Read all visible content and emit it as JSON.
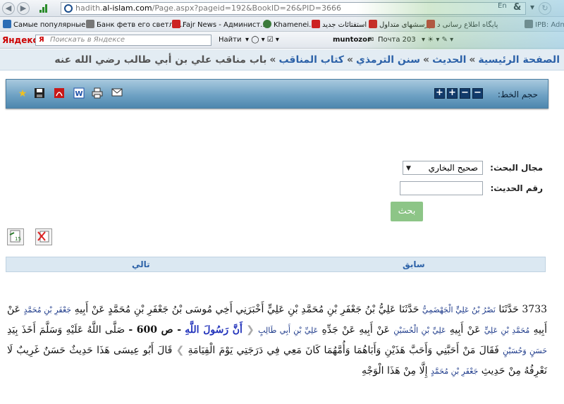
{
  "browser": {
    "url_prefix": "hadith.",
    "url_domain": "al-islam.com",
    "url_rest": "/Page.aspx?pageid=192&BookID=26&PID=3666",
    "lang_button": "En"
  },
  "bookmarks": {
    "items": [
      "Самые популярные",
      "Банк фетв его светло...",
      "Fajr News - Админист...",
      "Khamenei.ir",
      "استفتائات جدید",
      "پرسشهای متداول",
      "پایگاه اطلاع رسانی د",
      "IPB: Adm"
    ]
  },
  "yandex_bar": {
    "logo": "Яндекс",
    "search_placeholder": "Поискать в Яндексе",
    "find_label": "Найти",
    "user_label": "muntozor",
    "mail_label": "Почта 203"
  },
  "breadcrumb": {
    "home": "الصفحة الرئيسية",
    "hadith": "الحديث",
    "book": "سنن الترمذي",
    "section": "كتاب المناقب",
    "current": "باب مناقب علي بن أبي طالب رضي الله عنه"
  },
  "toolbar": {
    "font_size_label": "حجم الخط:",
    "icons": [
      "star-icon",
      "save-icon",
      "pdf-icon",
      "word-icon",
      "print-icon",
      "mail-icon"
    ]
  },
  "search": {
    "field_label": "مجال البحث:",
    "field_value": "صحيح البخاري",
    "number_label": "رقم الحديث:",
    "number_value": "",
    "submit_label": "بحث"
  },
  "navigation": {
    "prev_label": "سابق",
    "next_label": "تالي"
  },
  "hadith": {
    "number": "3733",
    "parts": [
      "حَدَّثَنَا",
      "نَصْرُ بْنُ عَلِيٍّ الْجَهْضَمِيُّ",
      "حَدَّثَنَا عَلِيُّ بْنُ جَعْفَرِ بْنِ مُحَمَّدِ بْنِ عَلِيٍّ أَخْبَرَنِي أَخِي مُوسَى بْنُ جَعْفَرِ بْنِ مُحَمَّدٍ عَنْ أَبِيهِ",
      "جَعْفَرِ بْنِ مُحَمَّدٍ",
      "عَنْ أَبِيهِ",
      "مُحَمَّدِ بْنِ عَلِيٍّ",
      "عَنْ أَبِيهِ",
      "عَلِيِّ بْنِ الْحُسَيْنِ",
      "عَنْ أَبِيهِ عَنْ جَدِّهِ",
      "عَلِيِّ بْنِ أَبِي طَالِبٍ",
      "أَنَّ رَسُولَ اللَّهِ",
      "- ص 600 -",
      "صَلَّى اللَّهُ عَلَيْهِ وَسَلَّمَ أَخَذَ بِيَدِ",
      "حَسَنٍ وَحُسَيْنٍ",
      "فَقَالَ مَنْ أَحَبَّنِي وَأَحَبَّ هَذَيْنِ وَأَبَاهُمَا وَأُمَّهُمَا كَانَ مَعِي فِي دَرَجَتِي يَوْمَ الْقِيَامَةِ",
      "قَالَ أَبُو عِيسَى هَذَا حَدِيثٌ حَسَنٌ غَرِيبٌ لَا نَعْرِفُهُ مِنْ حَدِيثِ",
      "جَعْفَرِ بْنِ مُحَمَّدٍ",
      "إِلَّا مِنْ هَذَا الْوَجْهِ"
    ]
  },
  "colors": {
    "link": "#2d62a8",
    "toolbar": "#6fa2c4",
    "search_button": "#8dc587",
    "quote": "#2233bb"
  }
}
